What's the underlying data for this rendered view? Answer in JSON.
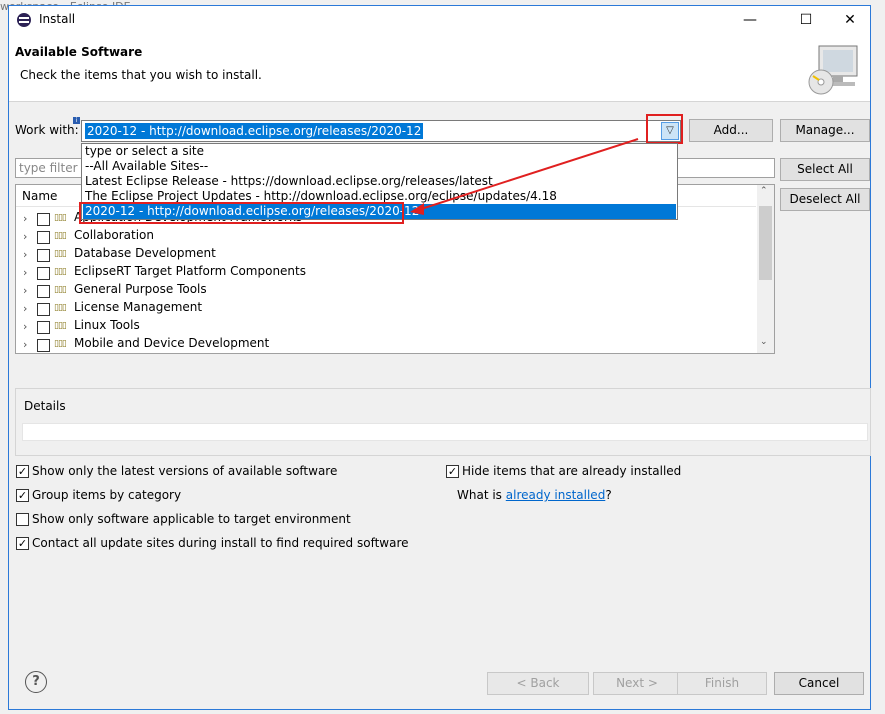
{
  "background_window": {
    "title": "workspace - Eclipse IDE"
  },
  "window": {
    "title": "Install",
    "minimize": "—",
    "maximize": "☐",
    "close": "✕"
  },
  "header": {
    "title": "Available Software",
    "description": "Check the items that you wish to install."
  },
  "work_with": {
    "label": "Work with:",
    "value": "2020-12 - http://download.eclipse.org/releases/2020-12",
    "add_label": "Add...",
    "manage_label": "Manage..."
  },
  "dropdown": {
    "items": [
      "type or select a site",
      "--All Available Sites--",
      "Latest Eclipse Release - https://download.eclipse.org/releases/latest",
      "The Eclipse Project Updates - http://download.eclipse.org/eclipse/updates/4.18",
      "2020-12 - http://download.eclipse.org/releases/2020-12"
    ],
    "selected_index": 4
  },
  "filter": {
    "placeholder": "type filter text"
  },
  "buttons": {
    "select_all": "Select All",
    "deselect_all": "Deselect All"
  },
  "tree": {
    "column": "Name",
    "rows": [
      "Application Development Frameworks",
      "Collaboration",
      "Database Development",
      "EclipseRT Target Platform Components",
      "General Purpose Tools",
      "License Management",
      "Linux Tools",
      "Mobile and Device Development"
    ]
  },
  "details": {
    "label": "Details"
  },
  "options": {
    "show_latest": {
      "label": "Show only the latest versions of available software",
      "checked": true
    },
    "group_by_category": {
      "label": "Group items by category",
      "checked": true
    },
    "target_env": {
      "label": "Show only software applicable to target environment",
      "checked": false
    },
    "contact_sites": {
      "label": "Contact all update sites during install to find required software",
      "checked": true
    },
    "hide_installed": {
      "label": "Hide items that are already installed",
      "checked": true
    },
    "what_is": "What is",
    "already_installed_link": "already installed",
    "question_mark": "?"
  },
  "footer": {
    "back": "< Back",
    "next": "Next >",
    "finish": "Finish",
    "cancel": "Cancel",
    "help": "?"
  },
  "colors": {
    "selection": "#0078d7",
    "annotation": "#e02020",
    "link": "#0066cc"
  }
}
